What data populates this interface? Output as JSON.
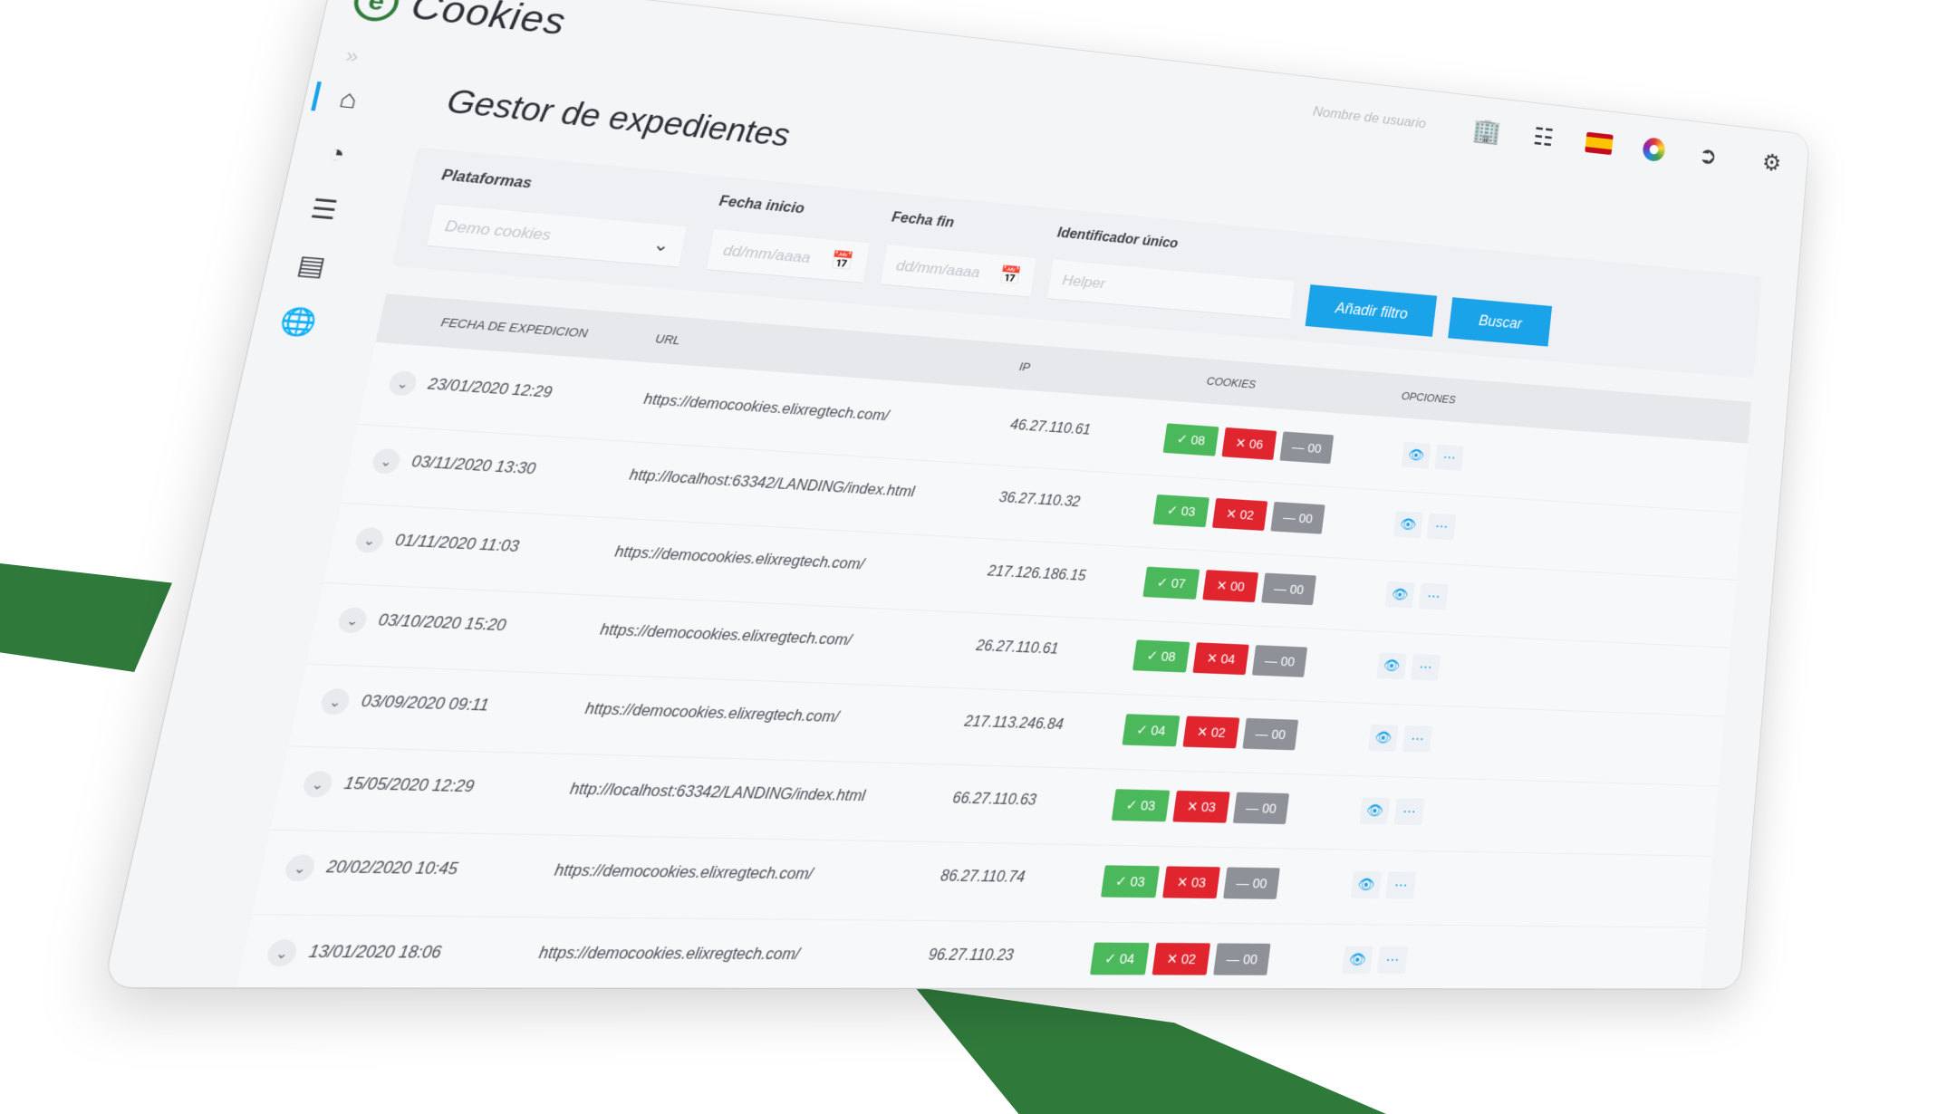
{
  "app": {
    "title": "Cookies",
    "logo_letter": "e",
    "user_placeholder": "Nombre de usuario"
  },
  "top_icons": [
    "building-icon",
    "grid-icon",
    "spain-flag-icon",
    "color-wheel-icon",
    "logout-icon",
    "settings-icon"
  ],
  "sidebar": {
    "expand_icon": "»",
    "items": [
      "home-icon",
      "chart-icon",
      "list-icon",
      "document-icon",
      "globe-icon"
    ]
  },
  "page": {
    "title": "Gestor de expedientes"
  },
  "filters": {
    "platform_label": "Plataformas",
    "platform_value": "Demo cookies",
    "start_label": "Fecha inicio",
    "start_placeholder": "dd/mm/aaaa",
    "end_label": "Fecha fin",
    "end_placeholder": "dd/mm/aaaa",
    "id_label": "Identificador único",
    "id_placeholder": "Helper",
    "add_filter": "Añadir filtro",
    "search": "Buscar"
  },
  "table": {
    "headers": {
      "date": "FECHA DE EXPEDICION",
      "url": "URL",
      "ip": "IP",
      "cookies": "COOKIES",
      "options": "OPCIONES"
    },
    "rows": [
      {
        "date": "23/01/2020 12:29",
        "url": "https://democookies.elixregtech.com/",
        "ip": "46.27.110.61",
        "ok": "✓ 08",
        "ko": "✕ 06",
        "na": "— 00"
      },
      {
        "date": "03/11/2020 13:30",
        "url": "http://localhost:63342/LANDING/index.html",
        "ip": "36.27.110.32",
        "ok": "✓ 03",
        "ko": "✕ 02",
        "na": "— 00"
      },
      {
        "date": "01/11/2020 11:03",
        "url": "https://democookies.elixregtech.com/",
        "ip": "217.126.186.15",
        "ok": "✓ 07",
        "ko": "✕ 00",
        "na": "— 00"
      },
      {
        "date": "03/10/2020 15:20",
        "url": "https://democookies.elixregtech.com/",
        "ip": "26.27.110.61",
        "ok": "✓ 08",
        "ko": "✕ 04",
        "na": "— 00"
      },
      {
        "date": "03/09/2020 09:11",
        "url": "https://democookies.elixregtech.com/",
        "ip": "217.113.246.84",
        "ok": "✓ 04",
        "ko": "✕ 02",
        "na": "— 00"
      },
      {
        "date": "15/05/2020 12:29",
        "url": "http://localhost:63342/LANDING/index.html",
        "ip": "66.27.110.63",
        "ok": "✓ 03",
        "ko": "✕ 03",
        "na": "— 00"
      },
      {
        "date": "20/02/2020 10:45",
        "url": "https://democookies.elixregtech.com/",
        "ip": "86.27.110.74",
        "ok": "✓ 03",
        "ko": "✕ 03",
        "na": "— 00"
      },
      {
        "date": "13/01/2020 18:06",
        "url": "https://democookies.elixregtech.com/",
        "ip": "96.27.110.23",
        "ok": "✓ 04",
        "ko": "✕ 02",
        "na": "— 00"
      }
    ]
  },
  "colors": {
    "accent": "#1aa3e8",
    "brand_green": "#2f7a3b",
    "ok": "#4cb85c",
    "ko": "#e0252f",
    "na": "#8e9298"
  }
}
